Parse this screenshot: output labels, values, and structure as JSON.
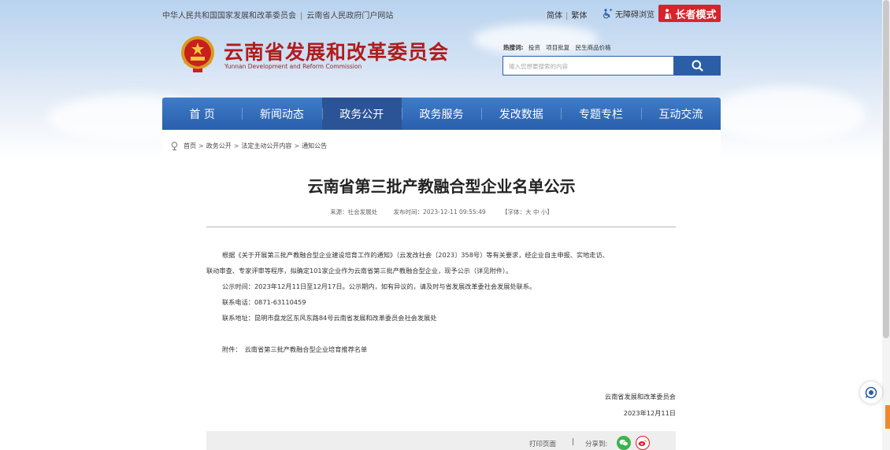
{
  "topbar": {
    "link1": "中华人民共和国国家发展和改革委员会",
    "separator": "|",
    "link2": "云南省人民政府门户网站"
  },
  "lang": {
    "simplified": "简体",
    "separator": "|",
    "traditional": "繁体"
  },
  "access": {
    "label": "无障碍浏览"
  },
  "elder_mode": {
    "label": "长者模式"
  },
  "site": {
    "title": "云南省发展和改革委员会",
    "subtitle": "Yunnan Development and Reform Commission"
  },
  "hot": {
    "label": "热搜词:",
    "keywords": [
      "投资",
      "项目批复",
      "民生商品价格"
    ]
  },
  "search": {
    "placeholder": "输入您想要搜索的内容"
  },
  "nav": {
    "items": [
      {
        "label": "首  页"
      },
      {
        "label": "新闻动态"
      },
      {
        "label": "政务公开"
      },
      {
        "label": "政务服务"
      },
      {
        "label": "发改数据"
      },
      {
        "label": "专题专栏"
      },
      {
        "label": "互动交流"
      }
    ],
    "active_index": 2
  },
  "breadcrumb": {
    "items": [
      "首页",
      "政务公开",
      "法定主动公开内容",
      "通知公告"
    ],
    "separator": ">"
  },
  "article": {
    "title": "云南省第三批产教融合型企业名单公示",
    "source": "来源：社会发展处",
    "published": "发布时间：2023-12-11 09:55:49",
    "font_size": "【字体：大 中 小】",
    "para1_line1": "根据《关于开展第三批产教融合型企业建设培育工作的通知》（云发改社会〔2023〕358号）等有关要求，经企业自主申报、实地走访、",
    "para1_line2": "联动审查、专家评审等程序，拟确定101家企业作为云南省第三批产教融合型企业，现予公示（详见附件）。",
    "notice_period": "公示时间：2023年12月11日至12月17日。公示期内，如有异议的，请及时与省发展改革委社会发展处联系。",
    "phone": "联系电话：0871-63110459",
    "address": "联系地址：昆明市盘龙区东风东路84号云南省发展和改革委员会社会发展处",
    "attachment_label": "附件：",
    "attachment_link": "云南省第三批产教融合型企业培育推荐名单",
    "signature_org": "云南省发展和改革委员会",
    "signature_date": "2023年12月11日"
  },
  "footer": {
    "print": "打印页面",
    "separator": "|",
    "share": "分享到:"
  },
  "colors": {
    "nav_blue": "#3f7cc8",
    "nav_active": "#2b5496",
    "brand_red": "#b01c1c",
    "elder_red": "#d7232a",
    "wechat_green": "#3bb54a",
    "weibo_red": "#e6162d"
  },
  "icons": [
    "emblem-icon",
    "accessibility-icon",
    "elder-icon",
    "search-icon",
    "breadcrumb-location-icon",
    "wechat-icon",
    "weibo-icon",
    "assistant-icon"
  ]
}
